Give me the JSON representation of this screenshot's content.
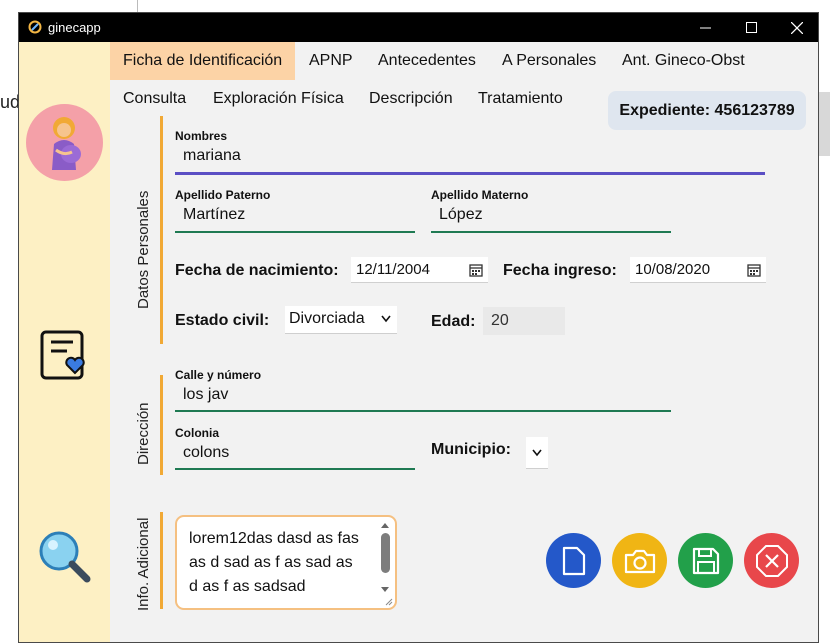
{
  "background": {
    "fragment_text": "ud"
  },
  "window": {
    "title": "ginecapp",
    "controls": {
      "minimize": "minimize-icon",
      "maximize": "maximize-icon",
      "close": "close-icon"
    }
  },
  "tabs": {
    "row1": [
      "Ficha de Identificación",
      "APNP",
      "Antecedentes",
      "A Personales",
      "Ant. Gineco-Obst"
    ],
    "row2": [
      "Consulta",
      "Exploración Física",
      "Descripción",
      "Tratamiento"
    ],
    "active": "Ficha de Identificación"
  },
  "expediente": "Expediente: 456123789",
  "groups": {
    "personal": "Datos Personales",
    "address": "Dirección",
    "extra": "Info. Adicional"
  },
  "personal": {
    "nombres_label": "Nombres",
    "nombres_value": "mariana",
    "apellido_paterno_label": "Apellido Paterno",
    "apellido_paterno_value": "Martínez",
    "apellido_materno_label": "Apellido Materno",
    "apellido_materno_value": "López",
    "fecha_nacimiento_label": "Fecha de nacimiento:",
    "fecha_nacimiento_value": "12/11/2004",
    "fecha_ingreso_label": "Fecha ingreso:",
    "fecha_ingreso_value": "10/08/2020",
    "estado_civil_label": "Estado civil:",
    "estado_civil_value": "Divorciada",
    "edad_label": "Edad:",
    "edad_value": "20"
  },
  "address": {
    "calle_label": "Calle y número",
    "calle_value": "los jav",
    "colonia_label": "Colonia",
    "colonia_value": "colons",
    "municipio_label": "Municipio:",
    "municipio_value": ""
  },
  "extra": {
    "notes_value": "lorem12das dasd as fas as d sad as f as sad as d as f as sadsad"
  },
  "colors": {
    "sidebar": "#fdf0c4",
    "active_tab": "#fcd3a6",
    "accent_orange": "#f1a935",
    "nombres_underline": "#5b4fc4",
    "field_underline": "#1f7a53",
    "btn_new": "#2458c9",
    "btn_photo": "#f0b514",
    "btn_save": "#22a04a",
    "btn_cancel": "#e8474b"
  },
  "actions": {
    "new": "new-document-icon",
    "photo": "camera-icon",
    "save": "save-icon",
    "cancel": "cancel-icon"
  }
}
